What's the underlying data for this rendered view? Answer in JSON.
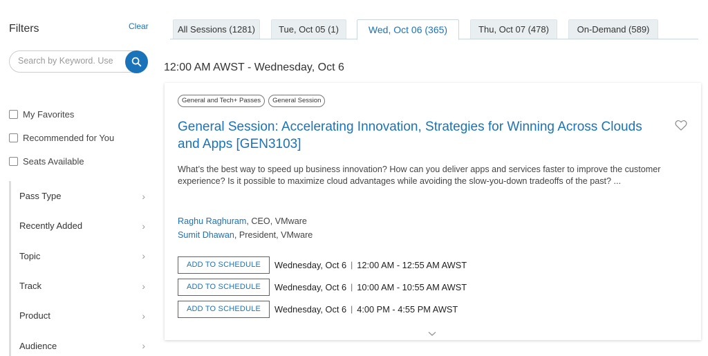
{
  "sidebar": {
    "title": "Filters",
    "clear_label": "Clear",
    "search_placeholder": "Search by Keyword. Use",
    "checkboxes": [
      {
        "label": "My Favorites"
      },
      {
        "label": "Recommended for You"
      },
      {
        "label": "Seats Available"
      }
    ],
    "facets": [
      {
        "label": "Pass Type"
      },
      {
        "label": "Recently Added"
      },
      {
        "label": "Topic"
      },
      {
        "label": "Track"
      },
      {
        "label": "Product"
      },
      {
        "label": "Audience"
      }
    ]
  },
  "tabs": [
    {
      "label": "All Sessions (1281)",
      "active": false
    },
    {
      "label": "Tue, Oct 05 (1)",
      "active": false
    },
    {
      "label": "Wed, Oct 06 (365)",
      "active": true
    },
    {
      "label": "Thu, Oct 07 (478)",
      "active": false
    },
    {
      "label": "On-Demand (589)",
      "active": false
    }
  ],
  "time_heading": "12:00 AM AWST - Wednesday, Oct 6",
  "session": {
    "badges": [
      "General and Tech+ Passes",
      "General Session"
    ],
    "title": "General Session: Accelerating Innovation, Strategies for Winning Across Clouds and Apps [GEN3103]",
    "description": "What’s the best way to speed up business innovation? How can you deliver apps and services faster to improve the customer experience? Is it possible to maximize cloud advantages while avoiding the slow-you-down tradeoffs of the past? ...",
    "speakers": [
      {
        "name": "Raghu Raghuram",
        "role": ", CEO, VMware"
      },
      {
        "name": "Sumit Dhawan",
        "role": ", President, VMware"
      }
    ],
    "schedule": [
      {
        "button": "ADD TO SCHEDULE",
        "day": "Wednesday, Oct 6",
        "sep": "|",
        "time": "12:00 AM - 12:55 AM AWST"
      },
      {
        "button": "ADD TO SCHEDULE",
        "day": "Wednesday, Oct 6",
        "sep": "|",
        "time": "10:00 AM - 10:55 AM AWST"
      },
      {
        "button": "ADD TO SCHEDULE",
        "day": "Wednesday, Oct 6",
        "sep": "|",
        "time": "4:00 PM - 4:55 PM AWST"
      }
    ]
  },
  "colors": {
    "accent": "#1a73b8",
    "tab_bg": "#e9eef1"
  },
  "icons": {
    "search": "search-icon",
    "favorite": "heart-icon",
    "expand": "chevron-down-icon",
    "facet": "chevron-right-icon"
  }
}
